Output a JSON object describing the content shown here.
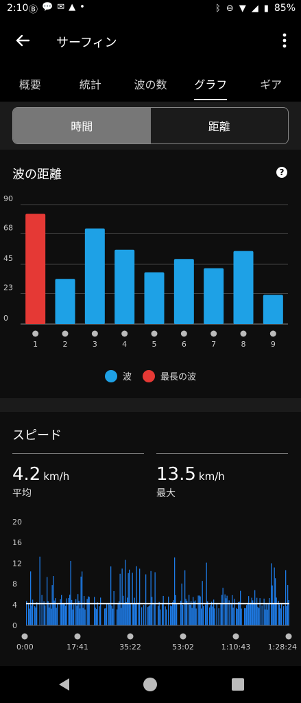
{
  "status_bar": {
    "time": "2:10",
    "battery": "85%",
    "left_icons": [
      "notification-badge-icon",
      "chat-icon",
      "messenger-icon",
      "warning-icon",
      "dot-icon"
    ],
    "right_icons": [
      "bluetooth-icon",
      "dnd-icon",
      "wifi-icon",
      "signal-icon",
      "battery-icon"
    ]
  },
  "app_bar": {
    "title": "サーフィン"
  },
  "tabs": [
    {
      "label": "概要"
    },
    {
      "label": "統計"
    },
    {
      "label": "波の数"
    },
    {
      "label": "グラフ",
      "active": true
    },
    {
      "label": "ギア"
    }
  ],
  "segment": [
    {
      "label": "時間",
      "active": true
    },
    {
      "label": "距離"
    }
  ],
  "wave_card": {
    "title": "波の距離",
    "legend": [
      {
        "label": "波",
        "color": "#1EA1E6"
      },
      {
        "label": "最長の波",
        "color": "#E53935"
      }
    ]
  },
  "speed_card": {
    "title": "スピード",
    "avg": {
      "value": "4.2",
      "unit": "km/h",
      "label": "平均"
    },
    "max": {
      "value": "13.5",
      "unit": "km/h",
      "label": "最大"
    }
  },
  "chart_data": [
    {
      "type": "bar",
      "title": "波の距離",
      "categories": [
        "1",
        "2",
        "3",
        "4",
        "5",
        "6",
        "7",
        "8",
        "9"
      ],
      "values": [
        83,
        34,
        72,
        56,
        39,
        49,
        42,
        55,
        22
      ],
      "highlight_index": 0,
      "colors": {
        "bar": "#1EA1E6",
        "highlight": "#E53935"
      },
      "ylim": [
        0,
        90
      ],
      "yticks": [
        "0",
        "23",
        "45",
        "68",
        "90"
      ],
      "grid": true
    },
    {
      "type": "bar",
      "title": "スピード",
      "x_tick_labels": [
        "0:00",
        "17:41",
        "35:22",
        "53:02",
        "1:10:43",
        "1:28:24"
      ],
      "yticks": [
        "0",
        "4",
        "8",
        "12",
        "16",
        "20"
      ],
      "ylim": [
        0,
        20
      ],
      "average": 4.2,
      "max": 13.5,
      "color": "#1E7BE6",
      "avg_line_color": "#FFFFFF"
    }
  ],
  "nav": {
    "back": "back-nav-icon",
    "home": "home-nav-icon",
    "recents": "recents-nav-icon"
  }
}
